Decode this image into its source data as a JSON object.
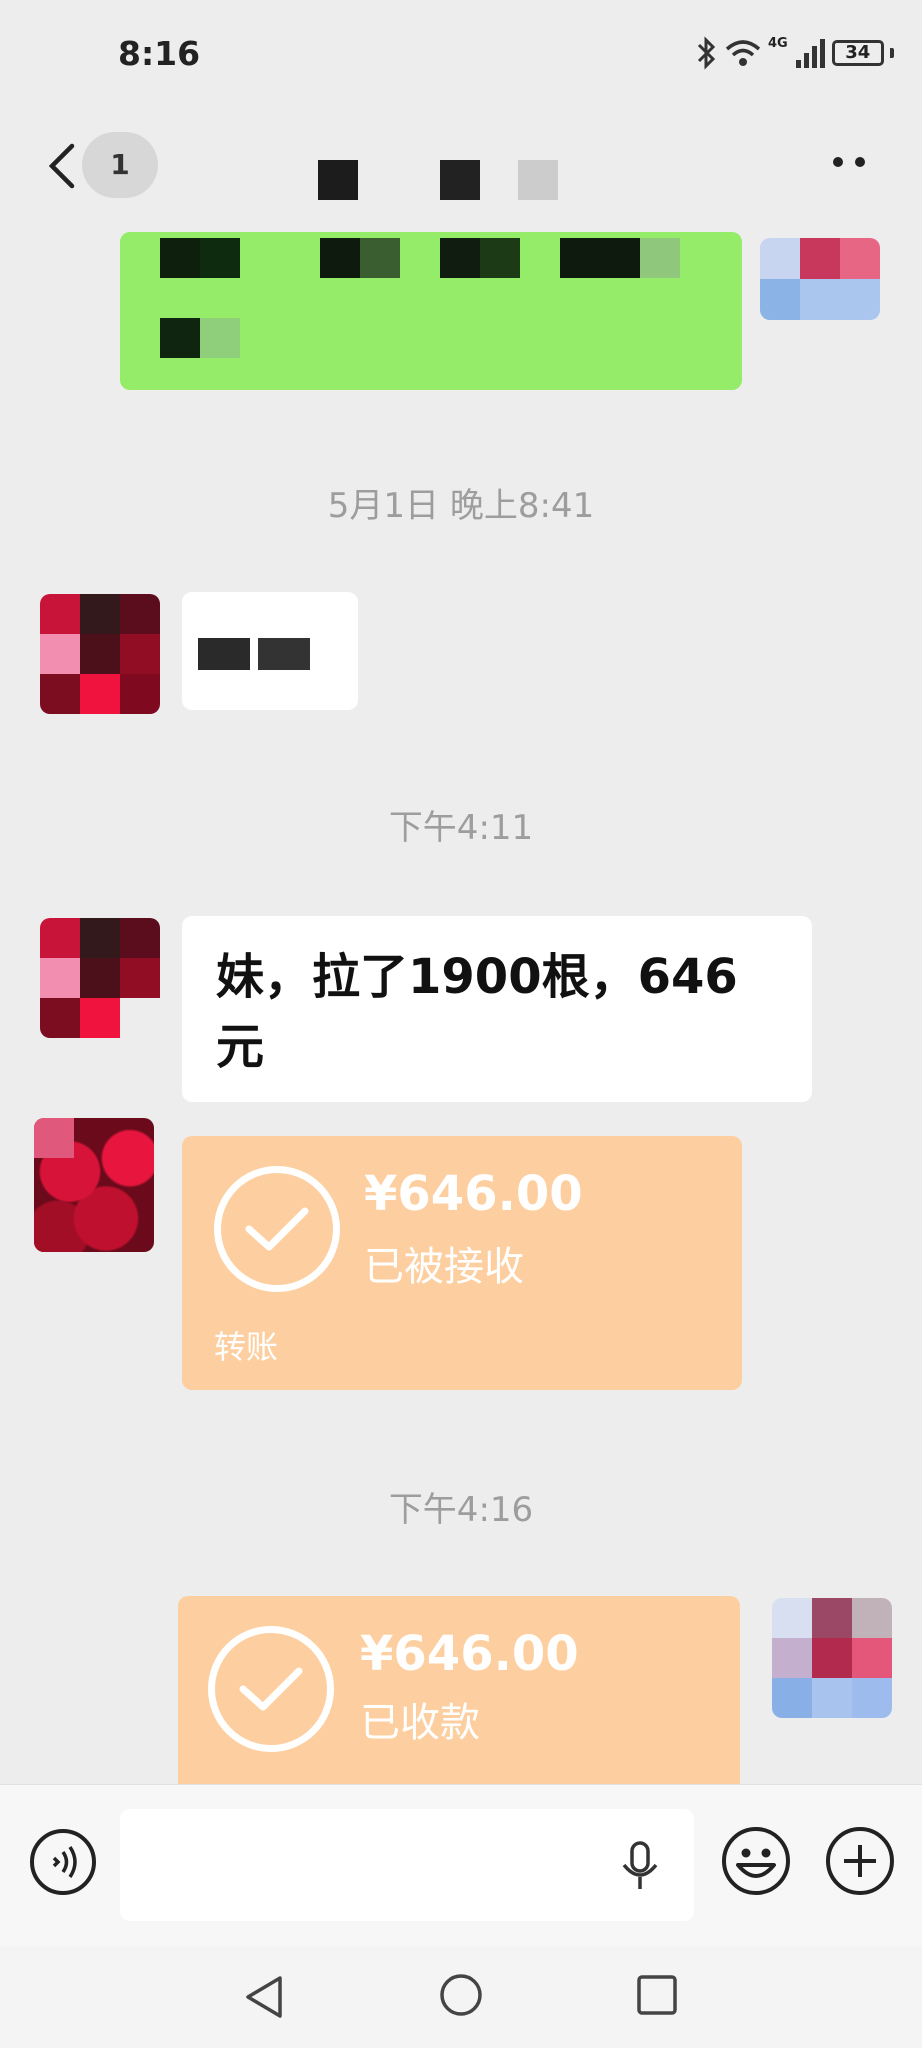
{
  "status_bar": {
    "time": "8:16",
    "network": "4G",
    "battery": "34"
  },
  "header": {
    "back_label": "<",
    "unread_count": "1"
  },
  "messages": {
    "ts1": "5月1日 晚上8:41",
    "ts2": "下午4:11",
    "text_message": "妹，拉了1900根，646 元",
    "transfer1": {
      "amount": "¥646.00",
      "status": "已被接收",
      "type": "转账"
    },
    "ts3": "下午4:16",
    "transfer2": {
      "amount": "¥646.00",
      "status": "已收款"
    }
  },
  "colors": {
    "sent_bubble": "#95ec69",
    "transfer": "#fdcfa0",
    "background": "#ededed"
  },
  "icons": [
    "back-icon",
    "more-icon",
    "voice-icon",
    "microphone-icon",
    "emoji-icon",
    "plus-icon",
    "nav-back-icon",
    "nav-home-icon",
    "nav-recents-icon"
  ]
}
